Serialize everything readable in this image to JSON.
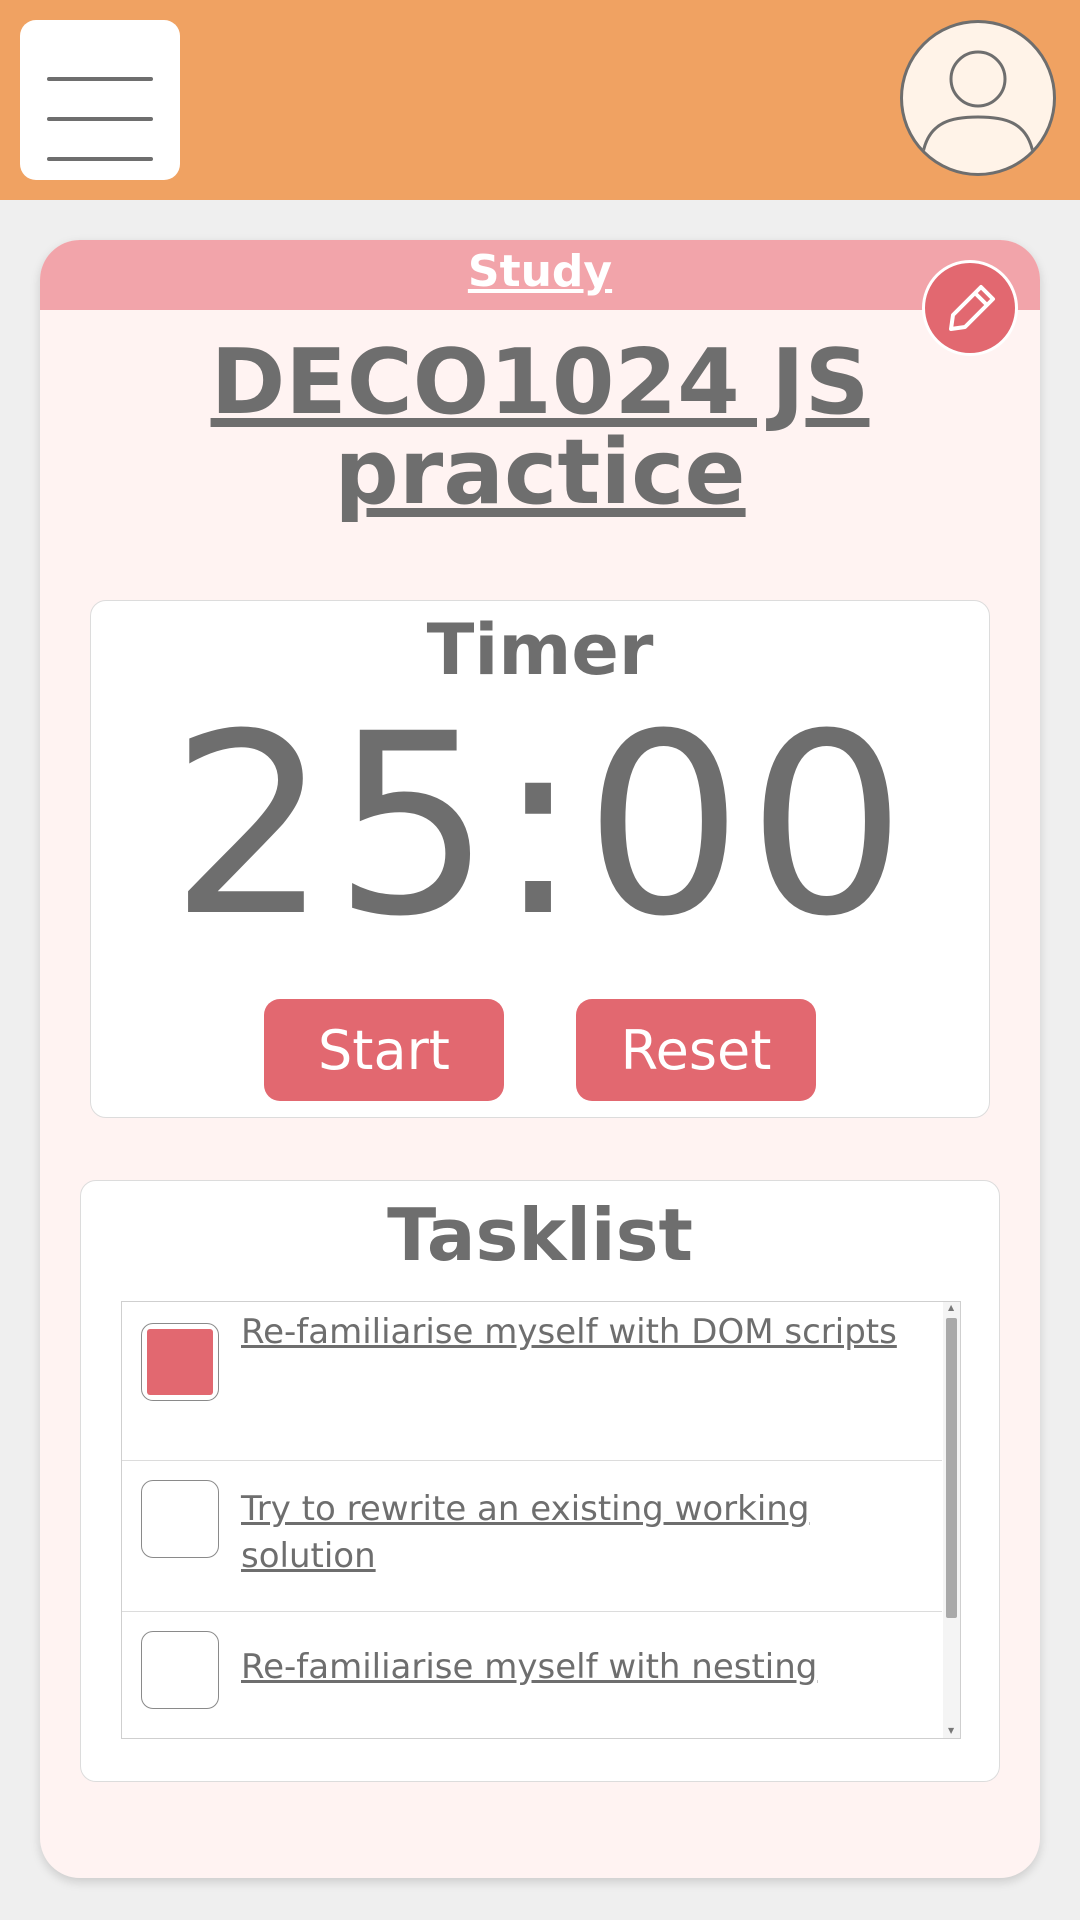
{
  "header": {
    "menu_icon": "hamburger-icon",
    "profile_icon": "user-icon"
  },
  "card": {
    "category": "Study",
    "title_line1": "DECO1024 JS",
    "title_line2": "practice",
    "edit_icon": "pencil-icon"
  },
  "timer": {
    "label": "Timer",
    "display": "25:00",
    "start_label": "Start",
    "reset_label": "Reset"
  },
  "tasklist": {
    "title": "Tasklist",
    "items": [
      {
        "text": "Re-familiarise myself with DOM scripts",
        "checked": true
      },
      {
        "text": "Try to rewrite an existing working solution",
        "checked": false
      },
      {
        "text": "Re-familiarise myself with nesting",
        "checked": false
      }
    ]
  },
  "colors": {
    "topbar": "#f0a262",
    "accent": "#e26870",
    "card_header": "#f2a4aa",
    "card_bg": "#fff3f2",
    "text": "#6e6e6e"
  }
}
